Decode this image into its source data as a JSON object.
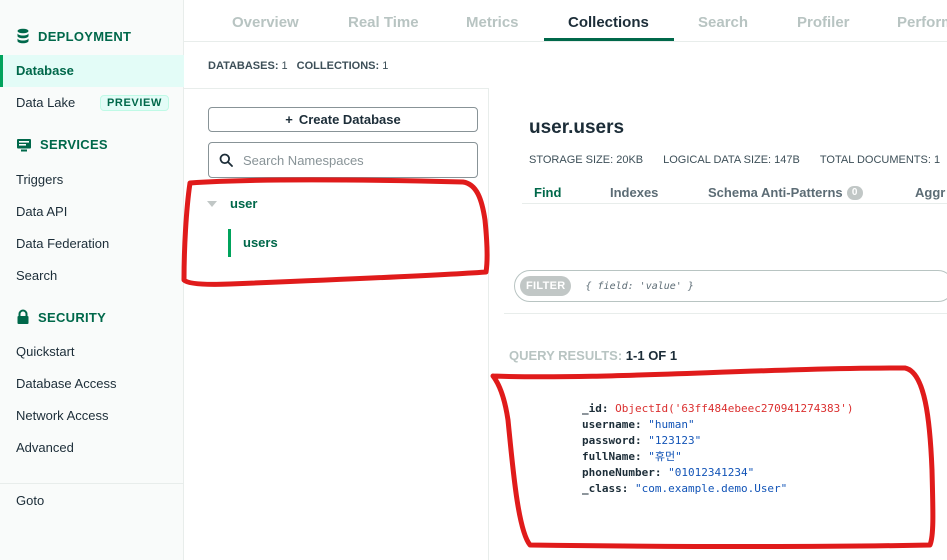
{
  "sidebar": {
    "sections": {
      "deployment": {
        "label": "DEPLOYMENT",
        "icon": "database-icon"
      },
      "services": {
        "label": "SERVICES",
        "icon": "services-icon"
      },
      "security": {
        "label": "SECURITY",
        "icon": "lock-icon"
      }
    },
    "items": {
      "database": "Database",
      "data_lake": "Data Lake",
      "preview_badge": "PREVIEW",
      "triggers": "Triggers",
      "data_api": "Data API",
      "data_federation": "Data Federation",
      "search": "Search",
      "quickstart": "Quickstart",
      "database_access": "Database Access",
      "network_access": "Network Access",
      "advanced": "Advanced",
      "goto": "Goto"
    }
  },
  "tabs": [
    "Overview",
    "Real Time",
    "Metrics",
    "Collections",
    "Search",
    "Profiler",
    "Perform"
  ],
  "active_tab": "Collections",
  "counts": {
    "databases_label": "DATABASES:",
    "databases_value": "1",
    "collections_label": "COLLECTIONS:",
    "collections_value": "1"
  },
  "namespace_panel": {
    "create_button": "Create Database",
    "create_icon": "+",
    "search_placeholder": "Search Namespaces",
    "database": "user",
    "collection": "users"
  },
  "collection": {
    "title": "user.users",
    "storage_size": "STORAGE SIZE: 20KB",
    "logical_size": "LOGICAL DATA SIZE: 147B",
    "total_documents": "TOTAL DOCUMENTS: 1",
    "subtabs": {
      "find": "Find",
      "indexes": "Indexes",
      "schema": "Schema Anti-Patterns",
      "schema_count": "0",
      "aggregation": "Aggr"
    }
  },
  "filter": {
    "badge": "FILTER",
    "placeholder": "{ field: 'value' }"
  },
  "results": {
    "label": "QUERY RESULTS:",
    "range": "1-1 OF 1"
  },
  "document": {
    "id_key": "_id:",
    "id_value": "ObjectId('63ff484ebeec270941274383')",
    "username_key": "username:",
    "username_value": "\"human\"",
    "password_key": "password:",
    "password_value": "\"123123\"",
    "fullname_key": "fullName:",
    "fullname_value": "\"휴먼\"",
    "phone_key": "phoneNumber:",
    "phone_value": "\"01012341234\"",
    "class_key": "_class:",
    "class_value": "\"com.example.demo.User\""
  },
  "colors": {
    "brand_green": "#00684a",
    "accent_green": "#00a35c",
    "annotation_red": "#e01b1b",
    "string_blue": "#1254b7",
    "objectid_red": "#db3030"
  }
}
